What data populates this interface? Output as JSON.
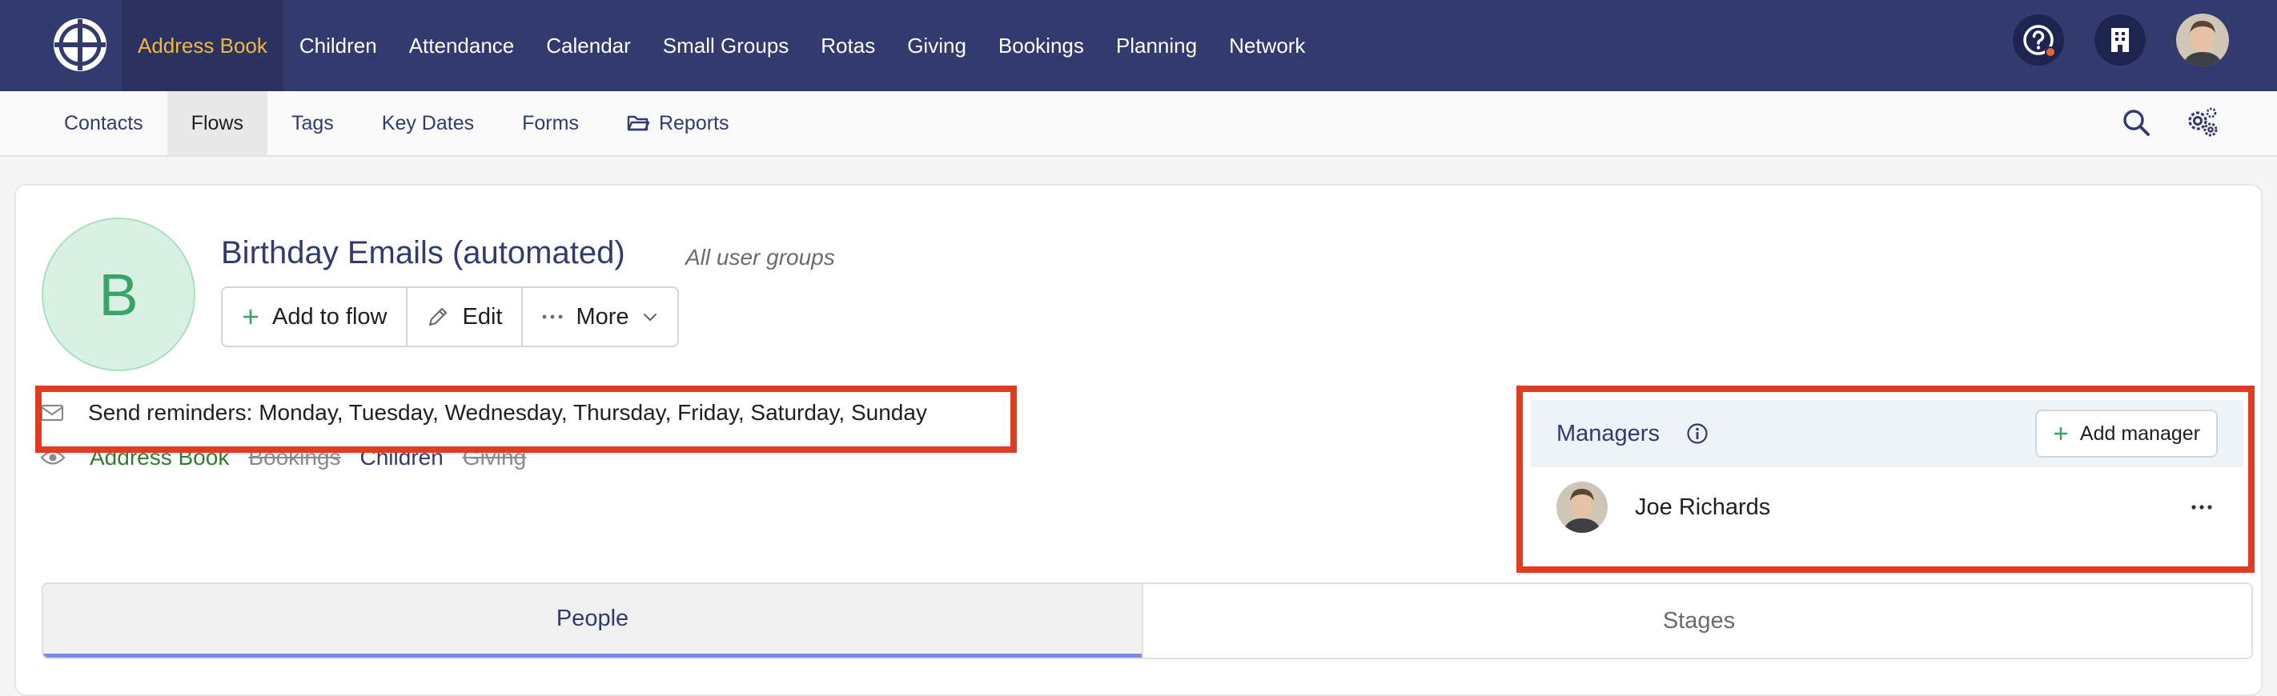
{
  "topnav": {
    "items": [
      {
        "label": "Address Book",
        "active": true
      },
      {
        "label": "Children"
      },
      {
        "label": "Attendance"
      },
      {
        "label": "Calendar"
      },
      {
        "label": "Small Groups"
      },
      {
        "label": "Rotas"
      },
      {
        "label": "Giving"
      },
      {
        "label": "Bookings"
      },
      {
        "label": "Planning"
      },
      {
        "label": "Network"
      }
    ],
    "icons": [
      "logo-icon",
      "help-icon",
      "building-icon",
      "user-avatar"
    ]
  },
  "subnav": {
    "items": [
      {
        "label": "Contacts"
      },
      {
        "label": "Flows",
        "active": true
      },
      {
        "label": "Tags"
      },
      {
        "label": "Key Dates"
      },
      {
        "label": "Forms"
      },
      {
        "label": "Reports",
        "icon": "folder-icon"
      }
    ],
    "right_icons": [
      "search-icon",
      "settings-icon"
    ]
  },
  "flow": {
    "avatar_letter": "B",
    "title": "Birthday Emails (automated)",
    "subtitle": "All user groups",
    "actions": {
      "add": "Add to flow",
      "edit": "Edit",
      "more": "More"
    },
    "reminders": "Send reminders: Monday, Tuesday, Wednesday, Thursday, Friday, Saturday, Sunday",
    "visibility": [
      {
        "label": "Address Book",
        "state": "enabled-green"
      },
      {
        "label": "Bookings",
        "state": "disabled"
      },
      {
        "label": "Children",
        "state": "enabled"
      },
      {
        "label": "Giving",
        "state": "disabled"
      }
    ]
  },
  "managers": {
    "title": "Managers",
    "add_label": "Add manager",
    "list": [
      {
        "name": "Joe Richards"
      }
    ]
  },
  "tabs": [
    {
      "label": "People",
      "active": true
    },
    {
      "label": "Stages"
    }
  ],
  "colors": {
    "nav_bg": "#333a6d",
    "accent": "#f3b93a",
    "highlight": "#e03c1f",
    "avatar_bg": "#d9f1e3"
  }
}
